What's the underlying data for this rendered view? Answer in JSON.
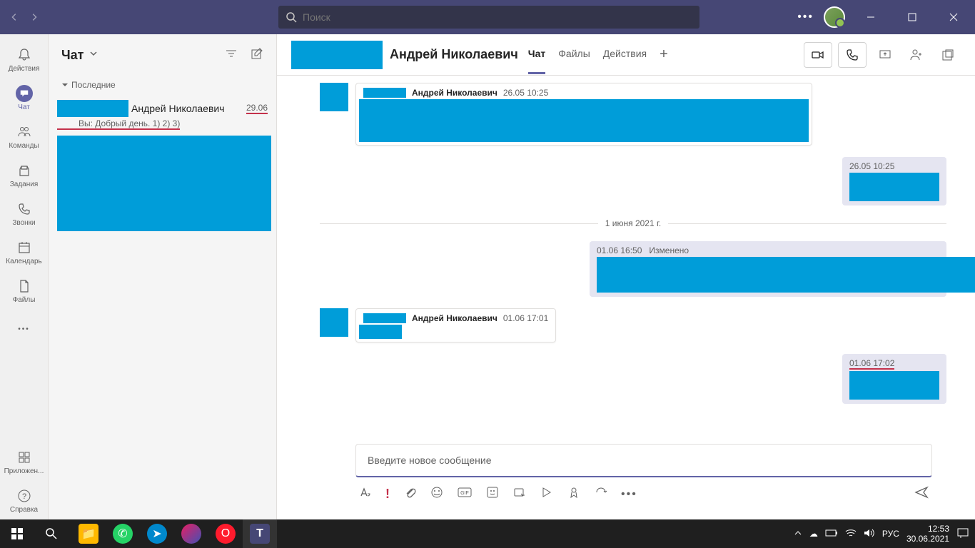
{
  "titlebar": {
    "search_placeholder": "Поиск"
  },
  "rail": {
    "activity": "Действия",
    "chat": "Чат",
    "teams": "Команды",
    "assignments": "Задания",
    "calls": "Звонки",
    "calendar": "Календарь",
    "files": "Файлы",
    "apps": "Приложен...",
    "help": "Справка"
  },
  "chatlist": {
    "title": "Чат",
    "section_recent": "Последние",
    "item": {
      "name": "Андрей Николаевич",
      "date": "29.06",
      "preview": "Вы: Добрый день. 1) 2) 3)"
    }
  },
  "chat_header": {
    "name": "Андрей Николаевич",
    "tabs": {
      "chat": "Чат",
      "files": "Файлы",
      "actions": "Действия"
    }
  },
  "messages": {
    "m1": {
      "sender": "Андрей Николаевич",
      "ts": "26.05 10:25"
    },
    "m2": {
      "ts": "26.05 10:25"
    },
    "sep1": "1 июня 2021 г.",
    "m3": {
      "ts": "01.06 16:50",
      "edited": "Изменено"
    },
    "m4": {
      "sender": "Андрей Николаевич",
      "ts": "01.06 17:01"
    },
    "m5": {
      "ts": "01.06 17:02"
    }
  },
  "compose": {
    "placeholder": "Введите новое сообщение"
  },
  "taskbar": {
    "lang": "РУС",
    "time": "12:53",
    "date": "30.06.2021"
  }
}
